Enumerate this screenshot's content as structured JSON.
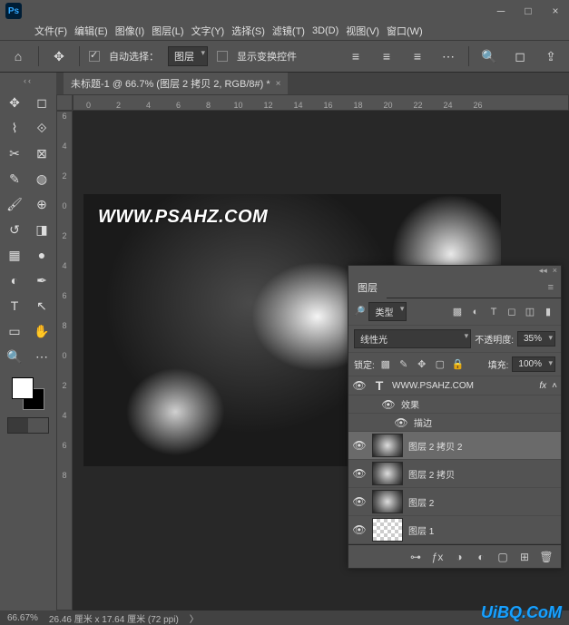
{
  "menubar": [
    "文件(F)",
    "编辑(E)",
    "图像(I)",
    "图层(L)",
    "文字(Y)",
    "选择(S)",
    "滤镜(T)",
    "3D(D)",
    "视图(V)",
    "窗口(W)"
  ],
  "options": {
    "auto_select_label": "自动选择：",
    "auto_select_target": "图层",
    "transform_label": "显示变换控件"
  },
  "tab": {
    "title": "未标题-1 @ 66.7% (图层 2 拷贝 2, RGB/8#) *"
  },
  "ruler_h": [
    "0",
    "2",
    "4",
    "6",
    "8",
    "10",
    "12",
    "14",
    "16",
    "18",
    "20",
    "22",
    "24",
    "26"
  ],
  "ruler_v": [
    "6",
    "4",
    "2",
    "0",
    "2",
    "4",
    "6",
    "8",
    "0",
    "2",
    "4",
    "6",
    "8"
  ],
  "canvas_text": "WWW.PSAHZ.COM",
  "layers": {
    "tab": "图层",
    "filter": "类型",
    "blend_mode": "线性光",
    "opacity_label": "不透明度:",
    "opacity_value": "35%",
    "lock_label": "锁定:",
    "fill_label": "填充:",
    "fill_value": "100%",
    "items": [
      {
        "name": "WWW.PSAHZ.COM",
        "type": "text",
        "fx": "fx"
      },
      {
        "name": "效果",
        "type": "fx-group"
      },
      {
        "name": "描边",
        "type": "fx-item"
      },
      {
        "name": "图层 2 拷贝 2",
        "type": "raster",
        "selected": true
      },
      {
        "name": "图层 2 拷贝",
        "type": "raster"
      },
      {
        "name": "图层 2",
        "type": "raster"
      },
      {
        "name": "图层 1",
        "type": "raster",
        "checker": true
      }
    ]
  },
  "status": {
    "zoom": "66.67%",
    "doc": "26.46 厘米 x 17.64 厘米 (72 ppi)"
  },
  "brand": "UiBQ.CoM"
}
